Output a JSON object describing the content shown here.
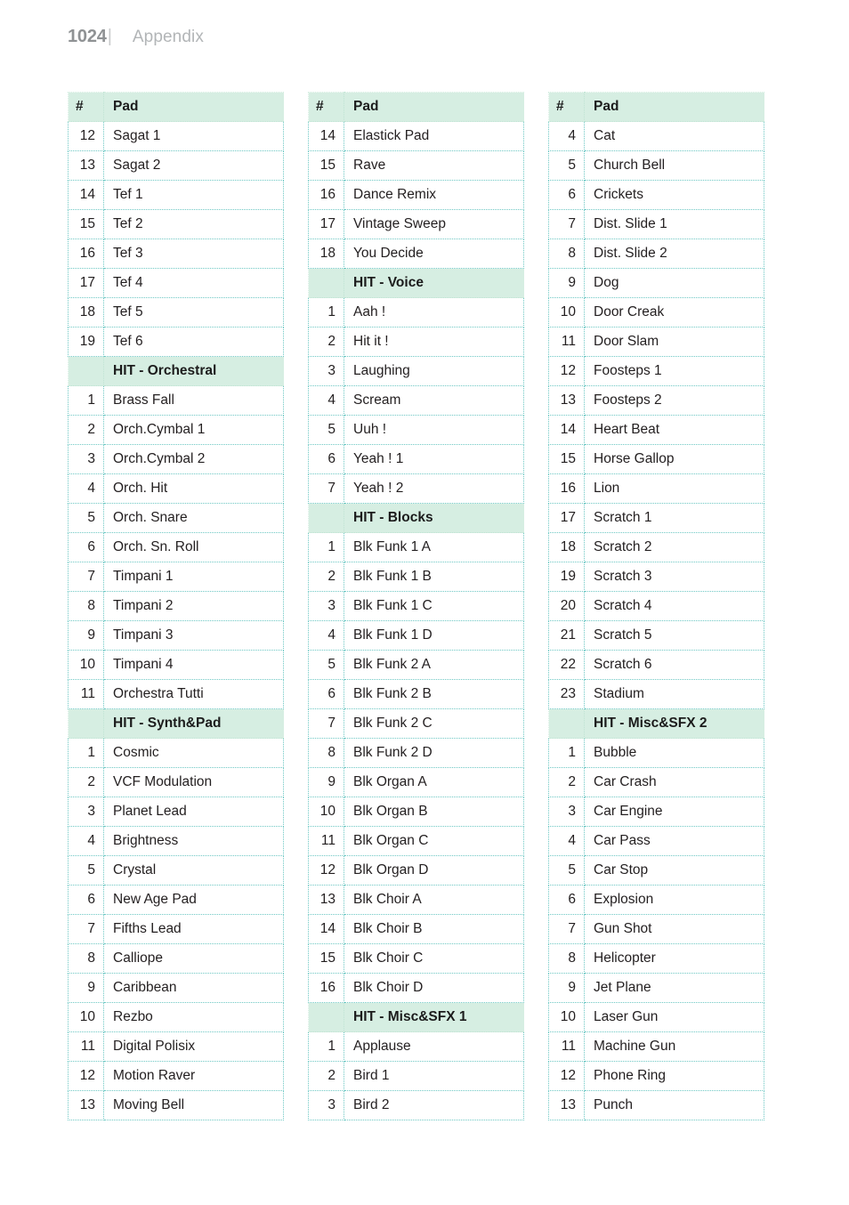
{
  "header": {
    "folio": "1024",
    "rule": "|",
    "title": "Appendix"
  },
  "table_headers": {
    "num": "#",
    "pad": "Pad"
  },
  "columns": [
    {
      "rows": [
        {
          "type": "data",
          "num": "12",
          "pad": "Sagat 1"
        },
        {
          "type": "data",
          "num": "13",
          "pad": "Sagat 2"
        },
        {
          "type": "data",
          "num": "14",
          "pad": "Tef 1"
        },
        {
          "type": "data",
          "num": "15",
          "pad": "Tef 2"
        },
        {
          "type": "data",
          "num": "16",
          "pad": "Tef 3"
        },
        {
          "type": "data",
          "num": "17",
          "pad": "Tef 4"
        },
        {
          "type": "data",
          "num": "18",
          "pad": "Tef 5"
        },
        {
          "type": "data",
          "num": "19",
          "pad": "Tef 6"
        },
        {
          "type": "section",
          "num": "",
          "pad": "HIT - Orchestral"
        },
        {
          "type": "data",
          "num": "1",
          "pad": "Brass Fall"
        },
        {
          "type": "data",
          "num": "2",
          "pad": "Orch.Cymbal 1"
        },
        {
          "type": "data",
          "num": "3",
          "pad": "Orch.Cymbal 2"
        },
        {
          "type": "data",
          "num": "4",
          "pad": "Orch. Hit"
        },
        {
          "type": "data",
          "num": "5",
          "pad": "Orch. Snare"
        },
        {
          "type": "data",
          "num": "6",
          "pad": "Orch. Sn. Roll"
        },
        {
          "type": "data",
          "num": "7",
          "pad": "Timpani 1"
        },
        {
          "type": "data",
          "num": "8",
          "pad": "Timpani 2"
        },
        {
          "type": "data",
          "num": "9",
          "pad": "Timpani 3"
        },
        {
          "type": "data",
          "num": "10",
          "pad": "Timpani 4"
        },
        {
          "type": "data",
          "num": "11",
          "pad": "Orchestra Tutti"
        },
        {
          "type": "section",
          "num": "",
          "pad": "HIT - Synth&Pad"
        },
        {
          "type": "data",
          "num": "1",
          "pad": "Cosmic"
        },
        {
          "type": "data",
          "num": "2",
          "pad": "VCF Modulation"
        },
        {
          "type": "data",
          "num": "3",
          "pad": "Planet Lead"
        },
        {
          "type": "data",
          "num": "4",
          "pad": "Brightness"
        },
        {
          "type": "data",
          "num": "5",
          "pad": "Crystal"
        },
        {
          "type": "data",
          "num": "6",
          "pad": "New Age Pad"
        },
        {
          "type": "data",
          "num": "7",
          "pad": "Fifths Lead"
        },
        {
          "type": "data",
          "num": "8",
          "pad": "Calliope"
        },
        {
          "type": "data",
          "num": "9",
          "pad": "Caribbean"
        },
        {
          "type": "data",
          "num": "10",
          "pad": "Rezbo"
        },
        {
          "type": "data",
          "num": "11",
          "pad": "Digital Polisix"
        },
        {
          "type": "data",
          "num": "12",
          "pad": "Motion Raver"
        },
        {
          "type": "data",
          "num": "13",
          "pad": "Moving Bell"
        }
      ]
    },
    {
      "rows": [
        {
          "type": "data",
          "num": "14",
          "pad": "Elastick Pad"
        },
        {
          "type": "data",
          "num": "15",
          "pad": "Rave"
        },
        {
          "type": "data",
          "num": "16",
          "pad": "Dance Remix"
        },
        {
          "type": "data",
          "num": "17",
          "pad": "Vintage Sweep"
        },
        {
          "type": "data",
          "num": "18",
          "pad": "You Decide"
        },
        {
          "type": "section",
          "num": "",
          "pad": "HIT - Voice"
        },
        {
          "type": "data",
          "num": "1",
          "pad": "Aah !"
        },
        {
          "type": "data",
          "num": "2",
          "pad": "Hit it !"
        },
        {
          "type": "data",
          "num": "3",
          "pad": "Laughing"
        },
        {
          "type": "data",
          "num": "4",
          "pad": "Scream"
        },
        {
          "type": "data",
          "num": "5",
          "pad": "Uuh !"
        },
        {
          "type": "data",
          "num": "6",
          "pad": "Yeah ! 1"
        },
        {
          "type": "data",
          "num": "7",
          "pad": "Yeah ! 2"
        },
        {
          "type": "section",
          "num": "",
          "pad": "HIT - Blocks"
        },
        {
          "type": "data",
          "num": "1",
          "pad": "Blk Funk 1 A"
        },
        {
          "type": "data",
          "num": "2",
          "pad": "Blk Funk 1 B"
        },
        {
          "type": "data",
          "num": "3",
          "pad": "Blk Funk 1 C"
        },
        {
          "type": "data",
          "num": "4",
          "pad": "Blk Funk 1 D"
        },
        {
          "type": "data",
          "num": "5",
          "pad": "Blk Funk 2 A"
        },
        {
          "type": "data",
          "num": "6",
          "pad": "Blk Funk 2 B"
        },
        {
          "type": "data",
          "num": "7",
          "pad": "Blk Funk 2 C"
        },
        {
          "type": "data",
          "num": "8",
          "pad": "Blk Funk 2 D"
        },
        {
          "type": "data",
          "num": "9",
          "pad": "Blk Organ A"
        },
        {
          "type": "data",
          "num": "10",
          "pad": "Blk Organ B"
        },
        {
          "type": "data",
          "num": "11",
          "pad": "Blk Organ C"
        },
        {
          "type": "data",
          "num": "12",
          "pad": "Blk Organ D"
        },
        {
          "type": "data",
          "num": "13",
          "pad": "Blk Choir A"
        },
        {
          "type": "data",
          "num": "14",
          "pad": "Blk Choir B"
        },
        {
          "type": "data",
          "num": "15",
          "pad": "Blk Choir C"
        },
        {
          "type": "data",
          "num": "16",
          "pad": "Blk Choir D"
        },
        {
          "type": "section",
          "num": "",
          "pad": "HIT - Misc&SFX 1"
        },
        {
          "type": "data",
          "num": "1",
          "pad": "Applause"
        },
        {
          "type": "data",
          "num": "2",
          "pad": "Bird 1"
        },
        {
          "type": "data",
          "num": "3",
          "pad": "Bird 2"
        }
      ]
    },
    {
      "rows": [
        {
          "type": "data",
          "num": "4",
          "pad": "Cat"
        },
        {
          "type": "data",
          "num": "5",
          "pad": "Church Bell"
        },
        {
          "type": "data",
          "num": "6",
          "pad": "Crickets"
        },
        {
          "type": "data",
          "num": "7",
          "pad": "Dist. Slide 1"
        },
        {
          "type": "data",
          "num": "8",
          "pad": "Dist. Slide 2"
        },
        {
          "type": "data",
          "num": "9",
          "pad": "Dog"
        },
        {
          "type": "data",
          "num": "10",
          "pad": "Door Creak"
        },
        {
          "type": "data",
          "num": "11",
          "pad": "Door Slam"
        },
        {
          "type": "data",
          "num": "12",
          "pad": "Foosteps 1"
        },
        {
          "type": "data",
          "num": "13",
          "pad": "Foosteps 2"
        },
        {
          "type": "data",
          "num": "14",
          "pad": "Heart Beat"
        },
        {
          "type": "data",
          "num": "15",
          "pad": "Horse Gallop"
        },
        {
          "type": "data",
          "num": "16",
          "pad": "Lion"
        },
        {
          "type": "data",
          "num": "17",
          "pad": "Scratch 1"
        },
        {
          "type": "data",
          "num": "18",
          "pad": "Scratch 2"
        },
        {
          "type": "data",
          "num": "19",
          "pad": "Scratch 3"
        },
        {
          "type": "data",
          "num": "20",
          "pad": "Scratch 4"
        },
        {
          "type": "data",
          "num": "21",
          "pad": "Scratch 5"
        },
        {
          "type": "data",
          "num": "22",
          "pad": "Scratch 6"
        },
        {
          "type": "data",
          "num": "23",
          "pad": "Stadium"
        },
        {
          "type": "section",
          "num": "",
          "pad": "HIT - Misc&SFX 2"
        },
        {
          "type": "data",
          "num": "1",
          "pad": "Bubble"
        },
        {
          "type": "data",
          "num": "2",
          "pad": "Car Crash"
        },
        {
          "type": "data",
          "num": "3",
          "pad": "Car Engine"
        },
        {
          "type": "data",
          "num": "4",
          "pad": "Car Pass"
        },
        {
          "type": "data",
          "num": "5",
          "pad": "Car Stop"
        },
        {
          "type": "data",
          "num": "6",
          "pad": "Explosion"
        },
        {
          "type": "data",
          "num": "7",
          "pad": "Gun Shot"
        },
        {
          "type": "data",
          "num": "8",
          "pad": "Helicopter"
        },
        {
          "type": "data",
          "num": "9",
          "pad": "Jet Plane"
        },
        {
          "type": "data",
          "num": "10",
          "pad": "Laser Gun"
        },
        {
          "type": "data",
          "num": "11",
          "pad": "Machine Gun"
        },
        {
          "type": "data",
          "num": "12",
          "pad": "Phone Ring"
        },
        {
          "type": "data",
          "num": "13",
          "pad": "Punch"
        }
      ]
    }
  ],
  "colors": {
    "section_background": "#d6eee2",
    "grid_line": "#6ec8c4",
    "text": "#231f20",
    "running_head": "#b2b5b7"
  }
}
